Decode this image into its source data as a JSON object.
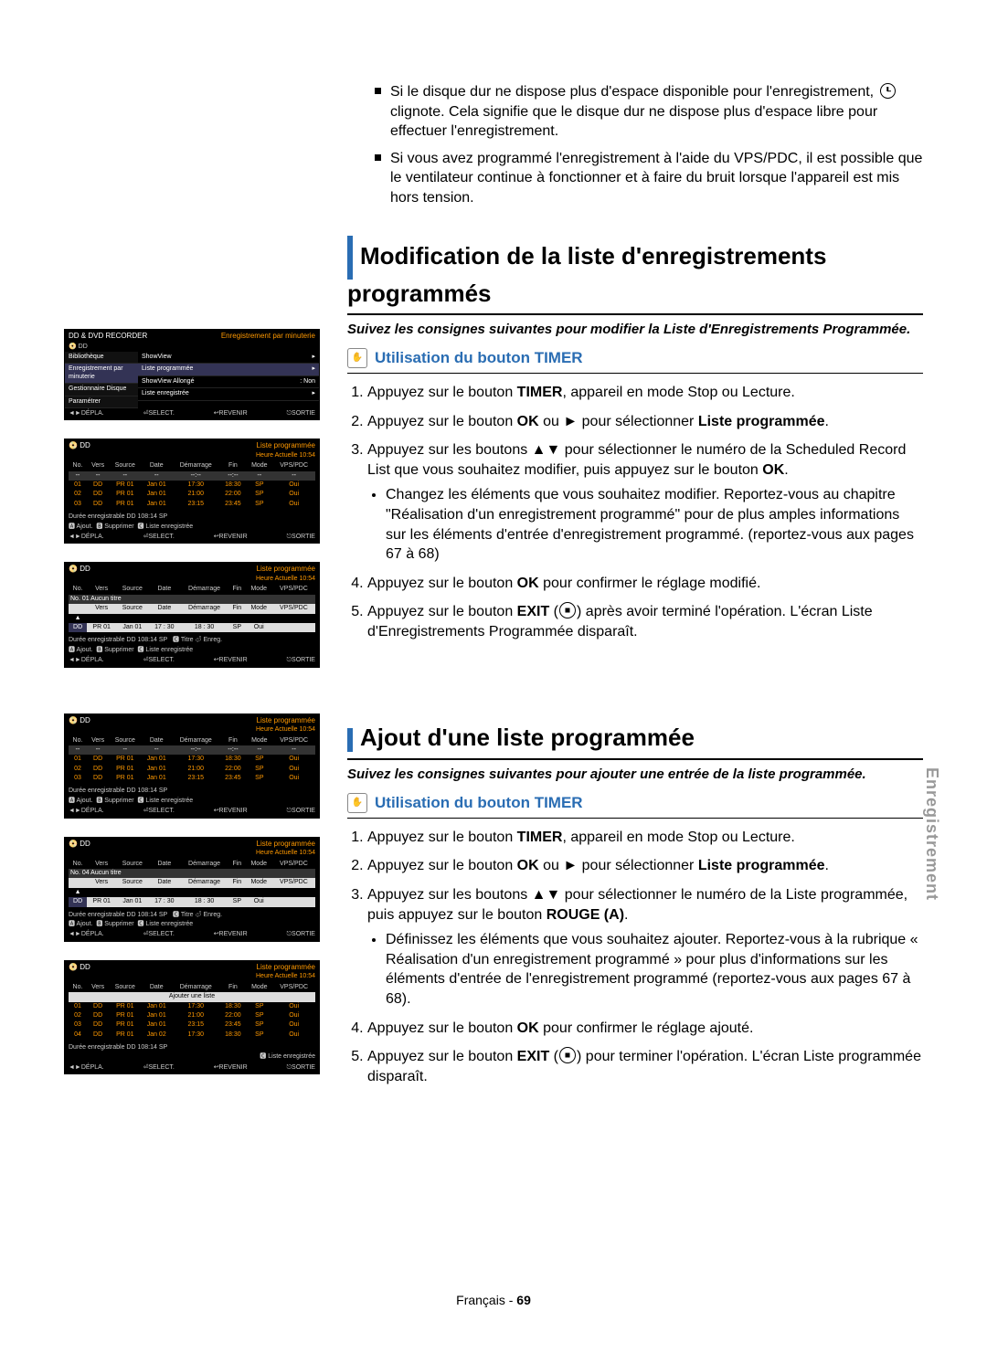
{
  "notes": [
    "Si le disque dur ne dispose plus d'espace disponible pour l'enregistrement, clignote. Cela signifie que le disque dur ne dispose plus d'espace libre pour effectuer l'enregistrement.",
    "Si vous avez programmé l'enregistrement à l'aide du VPS/PDC, il est possible que le ventilateur continue à fonctionner et à faire du bruit lorsque l'appareil est mis hors tension."
  ],
  "section_modify": {
    "title": "Modification de la liste d'enregistrements programmés",
    "intro": "Suivez les consignes suivantes pour modifier la Liste d'Enregistrements Programmée.",
    "subhead": "Utilisation du bouton TIMER",
    "steps": {
      "s1a": "Appuyez sur le bouton ",
      "s1b": "TIMER",
      "s1c": ", appareil en mode Stop ou Lecture.",
      "s2a": "Appuyez sur le bouton ",
      "s2b": "OK",
      "s2c": " ou ► pour sélectionner ",
      "s2d": "Liste programmée",
      "s2e": ".",
      "s3a": "Appuyez sur les boutons ▲▼ pour sélectionner le numéro de la Scheduled Record List que vous souhaitez modifier, puis appuyez sur le bouton ",
      "s3b": "OK",
      "s3c": ".",
      "s3sub": "Changez les éléments que vous souhaitez modifier. Reportez-vous au chapitre \"Réalisation d'un enregistrement programmé\" pour de plus amples informations sur les éléments d'entrée d'enregistrement programmé. (reportez-vous aux pages 67 à 68)",
      "s4a": "Appuyez sur le bouton ",
      "s4b": "OK",
      "s4c": " pour confirmer le réglage modifié.",
      "s5a": "Appuyez sur le bouton ",
      "s5b": "EXIT",
      "s5c": " après avoir terminé l'opération. L'écran Liste d'Enregistrements Programmée disparaît."
    }
  },
  "section_add": {
    "title": "Ajout d'une liste programmée",
    "intro": "Suivez les consignes suivantes pour ajouter une entrée de la liste programmée.",
    "subhead": "Utilisation du bouton TIMER",
    "steps": {
      "s1a": "Appuyez sur le bouton ",
      "s1b": "TIMER",
      "s1c": ", appareil en mode Stop ou Lecture.",
      "s2a": "Appuyez sur le bouton ",
      "s2b": "OK",
      "s2c": " ou ► pour sélectionner ",
      "s2d": "Liste programmée",
      "s2e": ".",
      "s3a": "Appuyez sur les boutons ▲▼ pour sélectionner le numéro de la Liste programmée, puis appuyez sur le bouton ",
      "s3b": "ROUGE (A)",
      "s3c": ".",
      "s3sub": "Définissez les éléments que vous souhaitez ajouter. Reportez-vous à la rubrique « Réalisation d'un enregistrement programmé » pour plus d'informations sur les éléments d'entrée de l'enregistrement programmé (reportez-vous aux pages 67 à 68).",
      "s4a": "Appuyez sur le bouton ",
      "s4b": "OK",
      "s4c": " pour confirmer le réglage ajouté.",
      "s5a": "Appuyez sur le bouton ",
      "s5b": "EXIT",
      "s5c": " pour terminer l'opération. L'écran Liste programmée disparaît."
    }
  },
  "side_tab": "Enregistrement",
  "footer": {
    "lang": "Français",
    "sep": " - ",
    "page": "69"
  },
  "mock_menu": {
    "header_l": "DD & DVD RECORDER",
    "header_r": "Enregistrement par minuterie",
    "dd": "DD",
    "left_items": [
      "Bibliothèque",
      "Enregistrement par minuterie",
      "Gestionnaire Disque",
      "Paramétrer"
    ],
    "right_items": [
      {
        "label": "ShowView",
        "val": ""
      },
      {
        "label": "Liste programmée",
        "val": ""
      },
      {
        "label": "ShowView Allongé",
        "val": ": Non"
      },
      {
        "label": "Liste enregistrée",
        "val": ""
      }
    ],
    "footer": [
      "◄►DÉPLA.",
      "⏎SELECT.",
      "↩REVENIR",
      "⎋SORTIE"
    ]
  },
  "mock_list": {
    "title_r": "Liste programmée",
    "time": "Heure Actuelle 10:54",
    "dd": "DD",
    "cols": [
      "No.",
      "Vers",
      "Source",
      "Date",
      "Démarrage",
      "Fin",
      "Mode",
      "VPS/PDC"
    ],
    "sym_row": [
      "--",
      "--",
      "--",
      "--",
      "--:--",
      "--:--",
      "--",
      "--"
    ],
    "rows": [
      [
        "01",
        "DD",
        "PR 01",
        "Jan 01",
        "17:30",
        "18:30",
        "SP",
        "Oui"
      ],
      [
        "02",
        "DD",
        "PR 01",
        "Jan 01",
        "21:00",
        "22:00",
        "SP",
        "Oui"
      ],
      [
        "03",
        "DD",
        "PR 01",
        "Jan 01",
        "23:15",
        "23:45",
        "SP",
        "Oui"
      ]
    ],
    "dur": "Durée enregistrable  DD  108:14 SP",
    "bar": [
      "🅰 Ajout.",
      "🅱 Supprimer",
      "🅲 Liste enregistrée"
    ],
    "footer": [
      "◄►DÉPLA.",
      "⏎SELECT.",
      "↩REVENIR",
      "⎋SORTIE"
    ]
  },
  "mock_edit": {
    "no_title": "No. 01 Aucun titre",
    "cols2": [
      "Vers",
      "Source",
      "Date",
      "Démarrage",
      "Fin",
      "Mode",
      "VPS/PDC"
    ],
    "row2": [
      "DD",
      "PR 01",
      "Jan 01",
      "17 : 30",
      "18 : 30",
      "SP",
      "Oui"
    ],
    "bar2": [
      "🅲 Titre",
      "⏎ Enreg."
    ]
  },
  "mock_add": {
    "no_title": "No. 04 Aucun titre",
    "sub": "Ajouter une liste",
    "rows4": [
      [
        "01",
        "DD",
        "PR 01",
        "Jan 01",
        "17:30",
        "18:30",
        "SP",
        "Oui"
      ],
      [
        "02",
        "DD",
        "PR 01",
        "Jan 01",
        "21:00",
        "22:00",
        "SP",
        "Oui"
      ],
      [
        "03",
        "DD",
        "PR 01",
        "Jan 01",
        "23:15",
        "23:45",
        "SP",
        "Oui"
      ],
      [
        "04",
        "DD",
        "PR 01",
        "Jan 02",
        "17:30",
        "18:30",
        "SP",
        "Oui"
      ]
    ]
  }
}
